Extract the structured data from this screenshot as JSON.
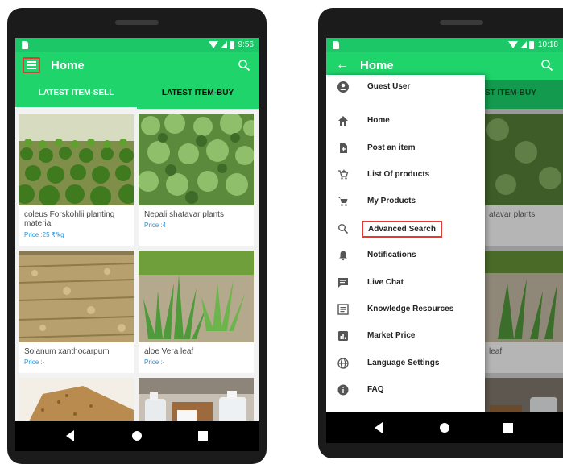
{
  "left_phone": {
    "status_time": "9:56",
    "title": "Home",
    "tabs": [
      "LATEST ITEM-SELL",
      "LATEST ITEM-BUY"
    ],
    "products": [
      {
        "name": "coleus Forskohlii planting material",
        "price": "Price :25 ₹/kg"
      },
      {
        "name": "Nepali shatavar plants",
        "price": "Price :4"
      },
      {
        "name": "Solanum xanthocarpum",
        "price": "Price :-"
      },
      {
        "name": "aloe Vera leaf",
        "price": "Price :-"
      }
    ]
  },
  "right_phone": {
    "status_time": "10:18",
    "title": "Home",
    "tab_partial": "ST ITEM-BUY",
    "peek_names": [
      "atavar plants",
      "leaf"
    ],
    "drawer_items": [
      {
        "label": "Guest User",
        "icon": "account-circle-icon"
      },
      {
        "label": "Home",
        "icon": "home-icon"
      },
      {
        "label": "Post an item",
        "icon": "post-file-icon"
      },
      {
        "label": "List Of products",
        "icon": "cart-add-icon"
      },
      {
        "label": "My Products",
        "icon": "cart-icon"
      },
      {
        "label": "Advanced Search",
        "icon": "search-icon"
      },
      {
        "label": "Notifications",
        "icon": "bell-icon"
      },
      {
        "label": "Live Chat",
        "icon": "chat-icon"
      },
      {
        "label": "Knowledge Resources",
        "icon": "list-doc-icon"
      },
      {
        "label": "Market Price",
        "icon": "bar-chart-icon"
      },
      {
        "label": "Language Settings",
        "icon": "globe-icon"
      },
      {
        "label": "FAQ",
        "icon": "info-icon"
      }
    ]
  },
  "colors": {
    "toolbar": "#1fd46b",
    "statusbar": "#1cc767",
    "highlight_outline": "#e53935",
    "price_text": "#2d96d8"
  }
}
